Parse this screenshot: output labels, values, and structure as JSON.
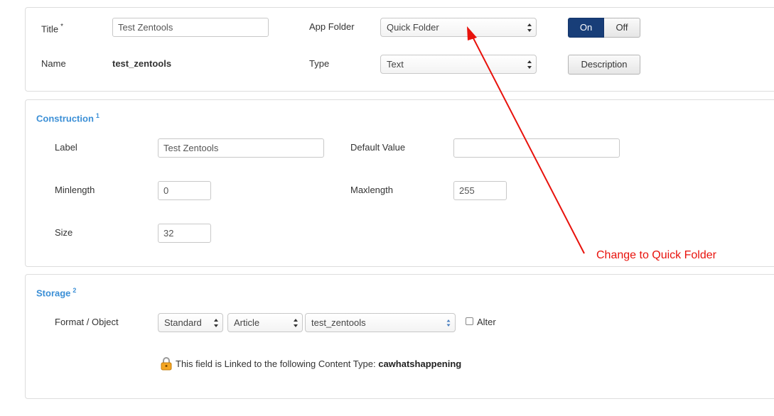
{
  "header": {
    "title_label": "Title",
    "required_mark": "*",
    "title_value": "Test Zentools",
    "app_folder_label": "App Folder",
    "app_folder_value": "Quick Folder",
    "toggle_on_label": "On",
    "toggle_off_label": "Off",
    "toggle_selected": "On",
    "name_label": "Name",
    "name_value": "test_zentools",
    "type_label": "Type",
    "type_value": "Text",
    "description_button": "Description"
  },
  "construction": {
    "title": "Construction",
    "badge": "1",
    "label_label": "Label",
    "label_value": "Test Zentools",
    "default_value_label": "Default Value",
    "default_value_value": "",
    "minlength_label": "Minlength",
    "minlength_value": "0",
    "maxlength_label": "Maxlength",
    "maxlength_value": "255",
    "size_label": "Size",
    "size_value": "32"
  },
  "storage": {
    "title": "Storage",
    "badge": "2",
    "format_label": "Format / Object",
    "format_value": "Standard",
    "object_value": "Article",
    "table_value": "test_zentools",
    "alter_label": "Alter",
    "alter_checked": false,
    "linked_note": "This field is Linked to the following Content Type:",
    "linked_content_type": "cawhatshappening"
  },
  "annotation": {
    "text": "Change to Quick Folder",
    "color": "#e8120c"
  },
  "colors": {
    "accent": "#3b8fd6",
    "toggle_active": "#183e78"
  },
  "icons": {
    "lock": "lock-icon",
    "select_arrows": "updown-arrows-icon",
    "annotation_arrow": "red-arrow"
  }
}
